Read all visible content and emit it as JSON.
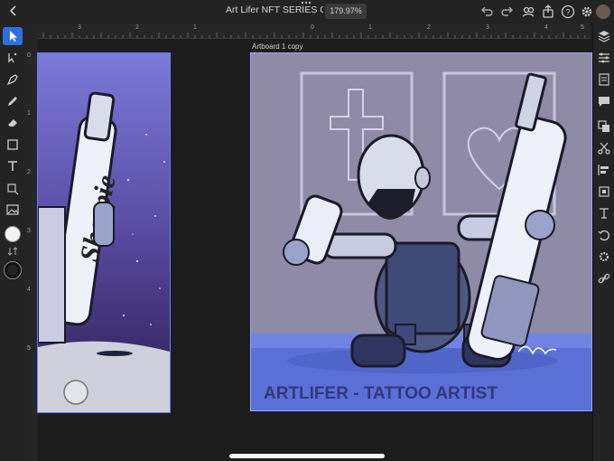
{
  "app": {
    "document_title": "Art Lifer NFT SERIES C",
    "zoom_level": "179.97%"
  },
  "artboard": {
    "right_label": "Artboard 1 copy"
  },
  "rulers": {
    "horizontal": [
      "3",
      "2",
      "1",
      "0",
      "1",
      "2",
      "3",
      "4",
      "5"
    ],
    "vertical": [
      "0",
      "1",
      "2",
      "3",
      "4",
      "5"
    ]
  },
  "artwork": {
    "caption": "ARTLIFER - TATTOO ARTIST",
    "marker_brand": "Sharpie"
  },
  "colors": {
    "accent": "#2f6fdd",
    "ui_bg": "#232323",
    "canvas_bg": "#1c1c1c",
    "left_artboard_sky": "#6d66c4",
    "right_artboard_bg": "#8f8aa6",
    "floor": "#5a6fd0"
  },
  "toolbar": {
    "left_tools": [
      "select-icon",
      "direct-select-icon",
      "pen-icon",
      "pencil-icon",
      "eraser-icon",
      "shape-icon",
      "text-icon",
      "transform-icon",
      "image-icon",
      "fill-swatch",
      "swap-icon",
      "stroke-swatch"
    ],
    "right_tools": [
      "layers-icon",
      "properties-icon",
      "libraries-icon",
      "comments-icon",
      "arrange-icon",
      "cut-icon",
      "align-icon",
      "crop-icon",
      "type-icon",
      "undo-path-icon",
      "settings-icon",
      "link-icon"
    ]
  }
}
